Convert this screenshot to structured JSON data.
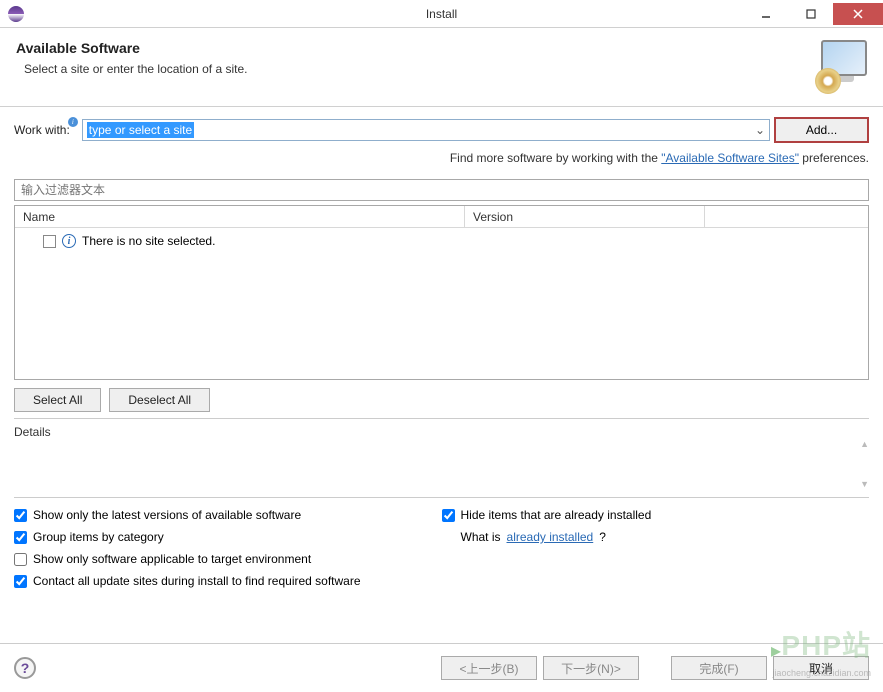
{
  "window": {
    "title": "Install",
    "heading": "Available Software",
    "subheading": "Select a site or enter the location of a site."
  },
  "workwith": {
    "label": "Work with:",
    "value": "type or select a site",
    "add_button": "Add..."
  },
  "findmore": {
    "prefix": "Find more software by working with the ",
    "link": "\"Available Software Sites\"",
    "suffix": " preferences."
  },
  "filter": {
    "placeholder": "输入过滤器文本"
  },
  "table": {
    "col_name": "Name",
    "col_version": "Version",
    "empty_message": "There is no site selected."
  },
  "buttons": {
    "select_all": "Select All",
    "deselect_all": "Deselect All"
  },
  "details": {
    "label": "Details"
  },
  "options": {
    "latest_versions": "Show only the latest versions of available software",
    "group_category": "Group items by category",
    "applicable_target": "Show only software applicable to target environment",
    "contact_sites": "Contact all update sites during install to find required software",
    "hide_installed": "Hide items that are already installed",
    "whatis_prefix": "What is ",
    "whatis_link": "already installed",
    "whatis_suffix": "?"
  },
  "footer": {
    "back": "<上一步(B)",
    "next": "下一步(N)>",
    "finish": "完成(F)",
    "cancel": "取消"
  },
  "checked": {
    "latest_versions": true,
    "group_category": true,
    "applicable_target": false,
    "contact_sites": true,
    "hide_installed": true
  }
}
